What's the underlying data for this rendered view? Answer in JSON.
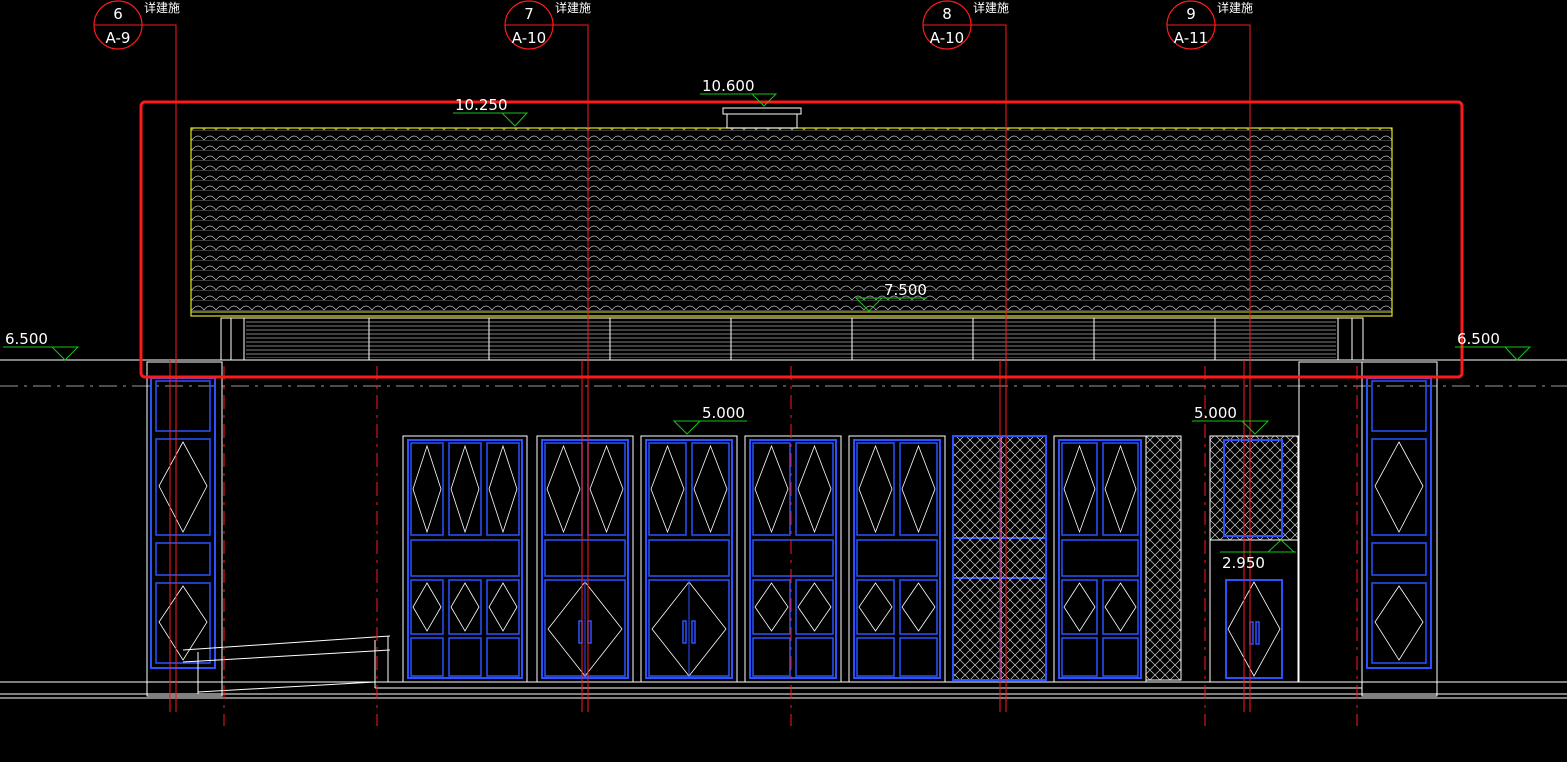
{
  "callouts": [
    {
      "number": "6",
      "sheet": "A-9",
      "note": "详建施"
    },
    {
      "number": "7",
      "sheet": "A-10",
      "note": "详建施"
    },
    {
      "number": "8",
      "sheet": "A-10",
      "note": "详建施"
    },
    {
      "number": "9",
      "sheet": "A-11",
      "note": "详建施"
    }
  ],
  "elevations": {
    "ridge": "10.600",
    "roof_eave": "10.250",
    "roof_base": "7.500",
    "left_level": "6.500",
    "right_level": "6.500",
    "window_head": "5.000",
    "right_window_head": "5.000",
    "right_door": "2.950"
  },
  "colors": {
    "background": "#000000",
    "lines": "#ffffff",
    "callout": "#ff1a1a",
    "elevation_marker": "#19c419",
    "frame": "#2a52ff",
    "roof_outline": "#e6e61a",
    "highlight_box": "#ff1a1a"
  }
}
